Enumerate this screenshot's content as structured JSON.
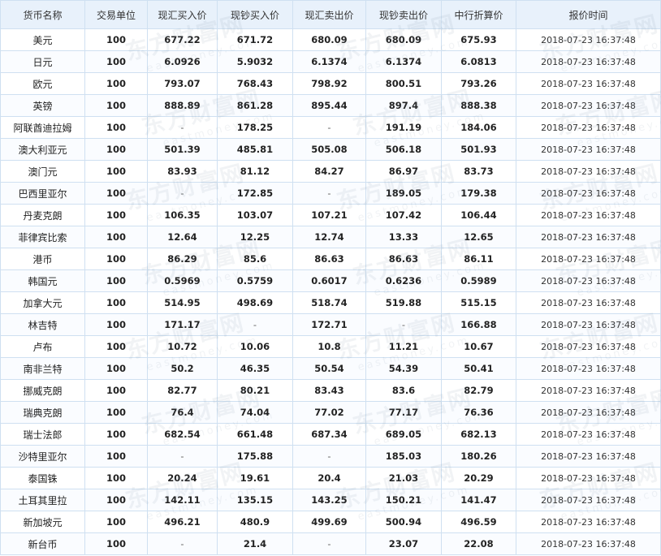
{
  "table": {
    "headers": [
      "货币名称",
      "交易单位",
      "现汇买入价",
      "现钞买入价",
      "现汇卖出价",
      "现钞卖出价",
      "中行折算价",
      "报价时间"
    ],
    "rows": [
      [
        "美元",
        "100",
        "677.22",
        "671.72",
        "680.09",
        "680.09",
        "675.93",
        "2018-07-23 16:37:48"
      ],
      [
        "日元",
        "100",
        "6.0926",
        "5.9032",
        "6.1374",
        "6.1374",
        "6.0813",
        "2018-07-23 16:37:48"
      ],
      [
        "欧元",
        "100",
        "793.07",
        "768.43",
        "798.92",
        "800.51",
        "793.26",
        "2018-07-23 16:37:48"
      ],
      [
        "英镑",
        "100",
        "888.89",
        "861.28",
        "895.44",
        "897.4",
        "888.38",
        "2018-07-23 16:37:48"
      ],
      [
        "阿联酋迪拉姆",
        "100",
        "-",
        "178.25",
        "-",
        "191.19",
        "184.06",
        "2018-07-23 16:37:48"
      ],
      [
        "澳大利亚元",
        "100",
        "501.39",
        "485.81",
        "505.08",
        "506.18",
        "501.93",
        "2018-07-23 16:37:48"
      ],
      [
        "澳门元",
        "100",
        "83.93",
        "81.12",
        "84.27",
        "86.97",
        "83.73",
        "2018-07-23 16:37:48"
      ],
      [
        "巴西里亚尔",
        "100",
        "-",
        "172.85",
        "-",
        "189.05",
        "179.38",
        "2018-07-23 16:37:48"
      ],
      [
        "丹麦克朗",
        "100",
        "106.35",
        "103.07",
        "107.21",
        "107.42",
        "106.44",
        "2018-07-23 16:37:48"
      ],
      [
        "菲律宾比索",
        "100",
        "12.64",
        "12.25",
        "12.74",
        "13.33",
        "12.65",
        "2018-07-23 16:37:48"
      ],
      [
        "港币",
        "100",
        "86.29",
        "85.6",
        "86.63",
        "86.63",
        "86.11",
        "2018-07-23 16:37:48"
      ],
      [
        "韩国元",
        "100",
        "0.5969",
        "0.5759",
        "0.6017",
        "0.6236",
        "0.5989",
        "2018-07-23 16:37:48"
      ],
      [
        "加拿大元",
        "100",
        "514.95",
        "498.69",
        "518.74",
        "519.88",
        "515.15",
        "2018-07-23 16:37:48"
      ],
      [
        "林吉特",
        "100",
        "171.17",
        "-",
        "172.71",
        "-",
        "166.88",
        "2018-07-23 16:37:48"
      ],
      [
        "卢布",
        "100",
        "10.72",
        "10.06",
        "10.8",
        "11.21",
        "10.67",
        "2018-07-23 16:37:48"
      ],
      [
        "南非兰特",
        "100",
        "50.2",
        "46.35",
        "50.54",
        "54.39",
        "50.41",
        "2018-07-23 16:37:48"
      ],
      [
        "挪威克朗",
        "100",
        "82.77",
        "80.21",
        "83.43",
        "83.6",
        "82.79",
        "2018-07-23 16:37:48"
      ],
      [
        "瑞典克朗",
        "100",
        "76.4",
        "74.04",
        "77.02",
        "77.17",
        "76.36",
        "2018-07-23 16:37:48"
      ],
      [
        "瑞士法郎",
        "100",
        "682.54",
        "661.48",
        "687.34",
        "689.05",
        "682.13",
        "2018-07-23 16:37:48"
      ],
      [
        "沙特里亚尔",
        "100",
        "-",
        "175.88",
        "-",
        "185.03",
        "180.26",
        "2018-07-23 16:37:48"
      ],
      [
        "泰国铢",
        "100",
        "20.24",
        "19.61",
        "20.4",
        "21.03",
        "20.29",
        "2018-07-23 16:37:48"
      ],
      [
        "土耳其里拉",
        "100",
        "142.11",
        "135.15",
        "143.25",
        "150.21",
        "141.47",
        "2018-07-23 16:37:48"
      ],
      [
        "新加坡元",
        "100",
        "496.21",
        "480.9",
        "499.69",
        "500.94",
        "496.59",
        "2018-07-23 16:37:48"
      ],
      [
        "新台币",
        "100",
        "-",
        "21.4",
        "-",
        "23.07",
        "22.08",
        "2018-07-23 16:37:48"
      ]
    ]
  },
  "watermark": {
    "text_cn": "东方财富网",
    "text_en": "eastmoney.com"
  }
}
